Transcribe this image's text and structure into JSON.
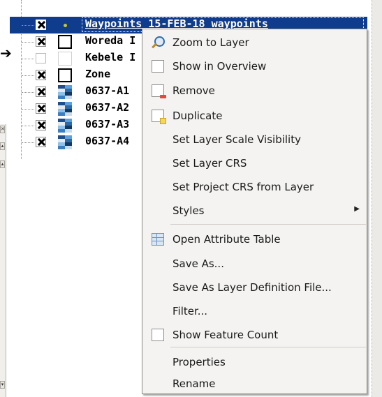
{
  "layers": [
    {
      "label": "Waypoints_15-FEB-18 waypoints",
      "checked": true,
      "symbol": "point",
      "selected": true
    },
    {
      "label": "Woreda I",
      "checked": true,
      "symbol": "polygon",
      "selected": false
    },
    {
      "label": "Kebele I",
      "checked": false,
      "symbol": "polygon-empty",
      "selected": false
    },
    {
      "label": "Zone",
      "checked": true,
      "symbol": "polygon",
      "selected": false
    },
    {
      "label": "0637-A1",
      "checked": true,
      "symbol": "raster",
      "selected": false
    },
    {
      "label": "0637-A2",
      "checked": true,
      "symbol": "raster",
      "selected": false
    },
    {
      "label": "0637-A3",
      "checked": true,
      "symbol": "raster",
      "selected": false
    },
    {
      "label": "0637-A4",
      "checked": true,
      "symbol": "raster",
      "selected": false
    }
  ],
  "context_menu": {
    "items": [
      {
        "label": "Zoom to Layer",
        "icon": "zoom-icon"
      },
      {
        "label": "Show in Overview",
        "icon": "checkbox-icon"
      },
      {
        "label": "Remove",
        "icon": "remove-layer-icon"
      },
      {
        "label": "Duplicate",
        "icon": "duplicate-layer-icon"
      },
      {
        "label": "Set Layer Scale Visibility",
        "icon": ""
      },
      {
        "label": "Set Layer CRS",
        "icon": ""
      },
      {
        "label": "Set Project CRS from Layer",
        "icon": ""
      },
      {
        "label": "Styles",
        "icon": "",
        "submenu": true
      },
      {
        "label": "Open Attribute Table",
        "icon": "attribute-table-icon"
      },
      {
        "label": "Save As...",
        "icon": ""
      },
      {
        "label": "Save As Layer Definition File...",
        "icon": ""
      },
      {
        "label": "Filter...",
        "icon": ""
      },
      {
        "label": "Show Feature Count",
        "icon": "checkbox-icon"
      },
      {
        "label": "Properties",
        "icon": ""
      },
      {
        "label": "Rename",
        "icon": ""
      }
    ]
  },
  "annotation": {
    "arrow": "➔"
  },
  "colors": {
    "selection": "#0f3c8c",
    "menu_bg": "#f4f3f1"
  }
}
